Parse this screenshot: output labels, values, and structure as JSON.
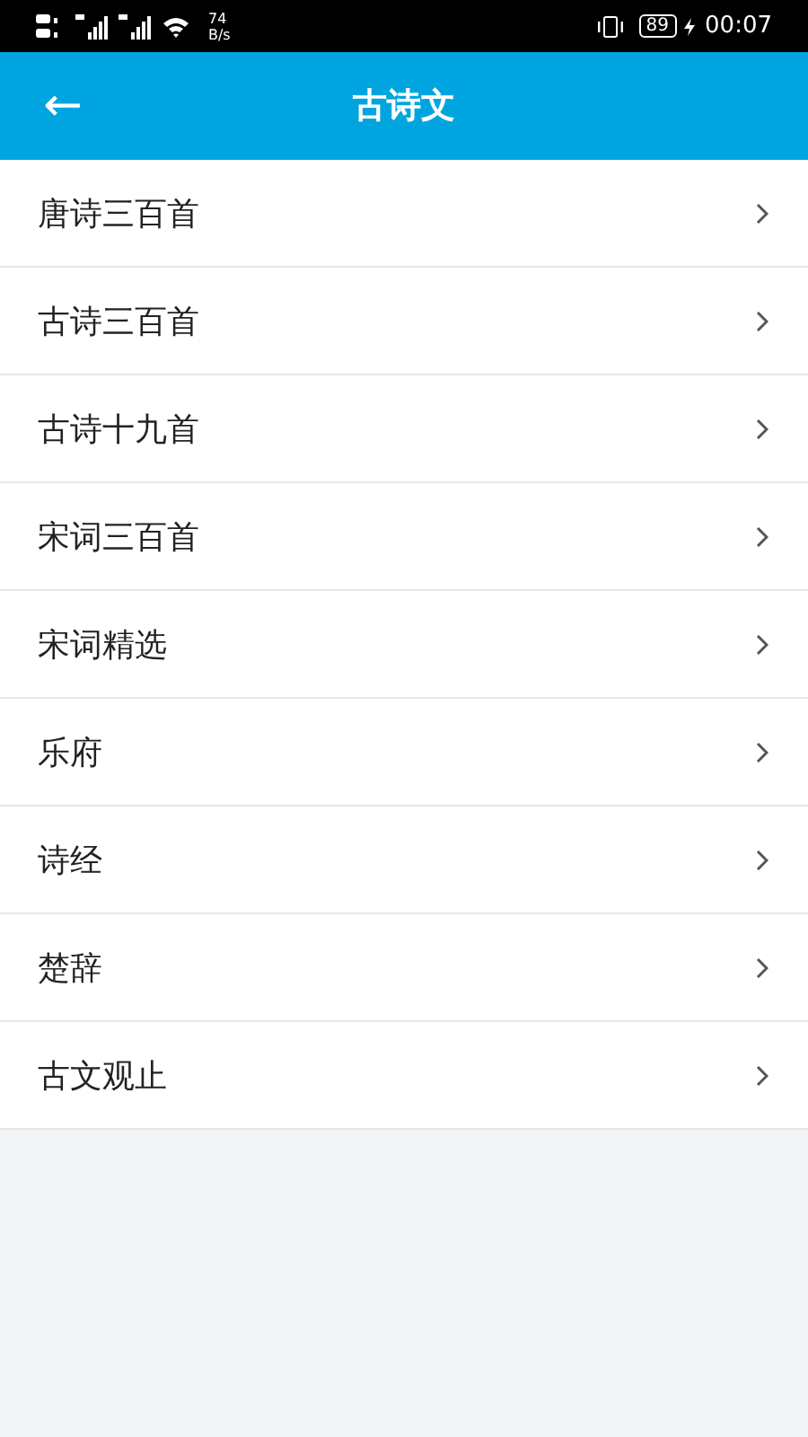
{
  "status_bar": {
    "speed": "74",
    "speed_unit": "B/s",
    "battery": "89",
    "time": "00:07"
  },
  "header": {
    "back": "←",
    "title": "古诗文"
  },
  "items": [
    {
      "label": "唐诗三百首"
    },
    {
      "label": "古诗三百首"
    },
    {
      "label": "古诗十九首"
    },
    {
      "label": "宋词三百首"
    },
    {
      "label": "宋词精选"
    },
    {
      "label": "乐府"
    },
    {
      "label": "诗经"
    },
    {
      "label": "楚辞"
    },
    {
      "label": "古文观止"
    }
  ]
}
